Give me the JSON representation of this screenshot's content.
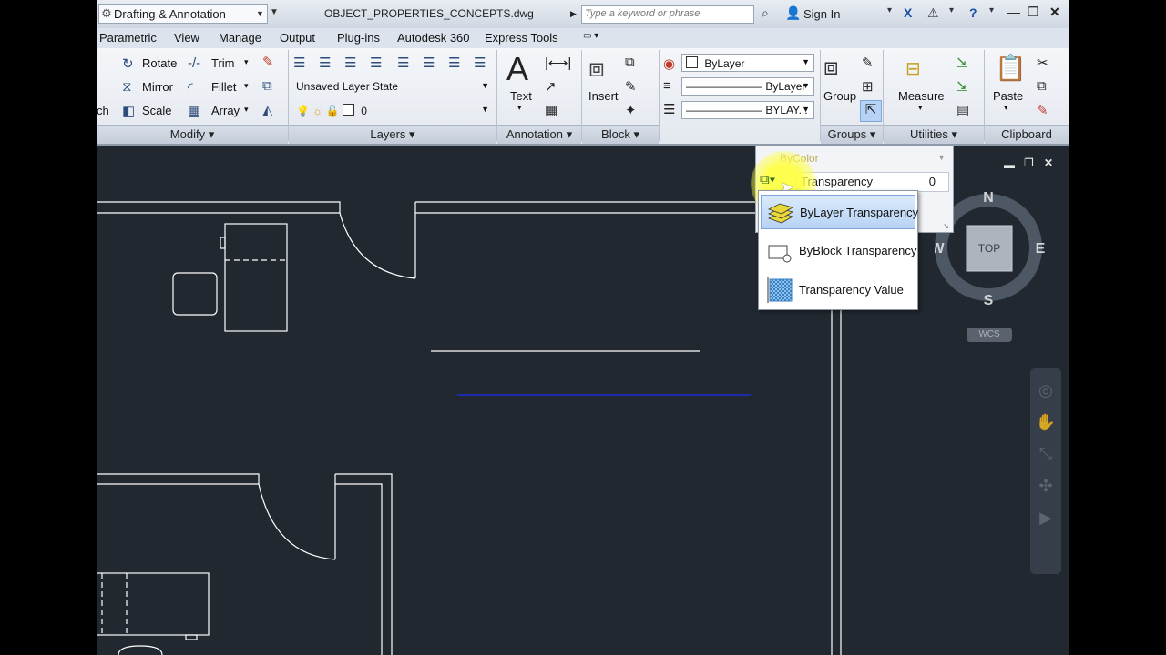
{
  "titlebar": {
    "workspace": "Drafting & Annotation",
    "document": "OBJECT_PROPERTIES_CONCEPTS.dwg",
    "search_placeholder": "Type a keyword or phrase",
    "sign_in": "Sign In"
  },
  "menu": [
    "Parametric",
    "View",
    "Manage",
    "Output",
    "Plug-ins",
    "Autodesk 360",
    "Express Tools"
  ],
  "ribbon": {
    "modify": {
      "title": "Modify",
      "items": [
        "Rotate",
        "Trim",
        "Mirror",
        "Fillet",
        "Scale",
        "Array",
        "ch"
      ]
    },
    "layers": {
      "title": "Layers",
      "layer_state": "Unsaved Layer State",
      "current_layer": "0"
    },
    "annotation": {
      "title": "Annotation",
      "text_label": "Text"
    },
    "block": {
      "title": "Block",
      "insert_label": "Insert"
    },
    "properties": {
      "color": "ByLayer",
      "linetype": "ByLayer",
      "lineweight": "BYLAY..."
    },
    "groups": {
      "title": "Groups",
      "group_label": "Group"
    },
    "utilities": {
      "title": "Utilities",
      "measure_label": "Measure"
    },
    "clipboard": {
      "title": "Clipboard",
      "paste_label": "Paste"
    }
  },
  "properties_panel": {
    "plot_style": "ByColor",
    "transparency_label": "Transparency",
    "transparency_value": "0"
  },
  "transparency_menu": {
    "items": [
      "ByLayer Transparency",
      "ByBlock Transparency",
      "Transparency Value"
    ],
    "selected": "ByLayer Transparency"
  },
  "viewcube": {
    "north": "N",
    "south": "S",
    "east": "E",
    "west": "W",
    "face": "TOP",
    "ucs": "WCS"
  },
  "colors": {
    "canvas": "#212830",
    "highlight": "#ffff46",
    "selection": "#b6d3f5",
    "drawing_line": "#ffffff",
    "blue_line": "#1a2bd6"
  }
}
